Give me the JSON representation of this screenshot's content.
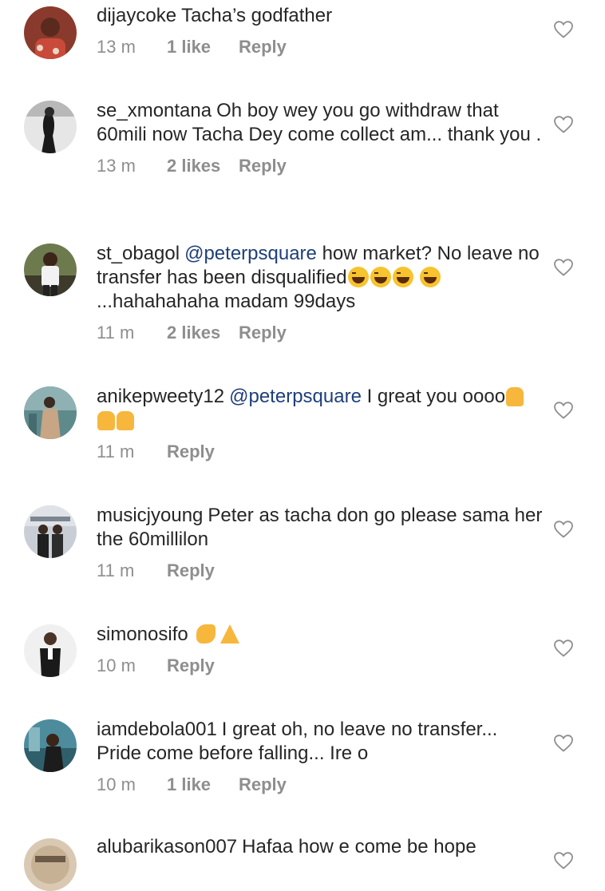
{
  "comments": [
    {
      "username": "dijaycoke",
      "text": "Tacha’s godfather",
      "time": "13 m",
      "likes": "1 like",
      "reply": "Reply"
    },
    {
      "username": "se_xmontana",
      "text": "Oh boy wey you go withdraw that 60mili now Tacha Dey come collect am... thank you .",
      "time": "13 m",
      "likes": "2 likes",
      "reply": "Reply"
    },
    {
      "username": "st_obagol",
      "mention": "@peterpsquare",
      "text_before_emoji": "how market? No leave no transfer has been disqualified",
      "text_after_emoji": "...hahahahaha madam 99days",
      "time": "11 m",
      "likes": "2 likes",
      "reply": "Reply"
    },
    {
      "username": "anikepweety12",
      "mention": "@peterpsquare",
      "text": "I great you oooo",
      "time": "11 m",
      "reply": "Reply"
    },
    {
      "username": "musicjyoung",
      "text": "Peter as tacha don go please sama her the 60millilon",
      "time": "11 m",
      "reply": "Reply"
    },
    {
      "username": "simonosifo",
      "time": "10 m",
      "reply": "Reply"
    },
    {
      "username": "iamdebola001",
      "text": "I great oh, no leave no transfer... Pride come before falling... Ire o",
      "time": "10 m",
      "likes": "1 like",
      "reply": "Reply"
    },
    {
      "username": "alubarikason007",
      "text": "Hafaa how e come be hope"
    }
  ],
  "icons": {
    "like": "heart-outline-icon"
  },
  "colors": {
    "text": "#262626",
    "meta": "#8e8e8e",
    "mention": "#1e3f7a"
  }
}
